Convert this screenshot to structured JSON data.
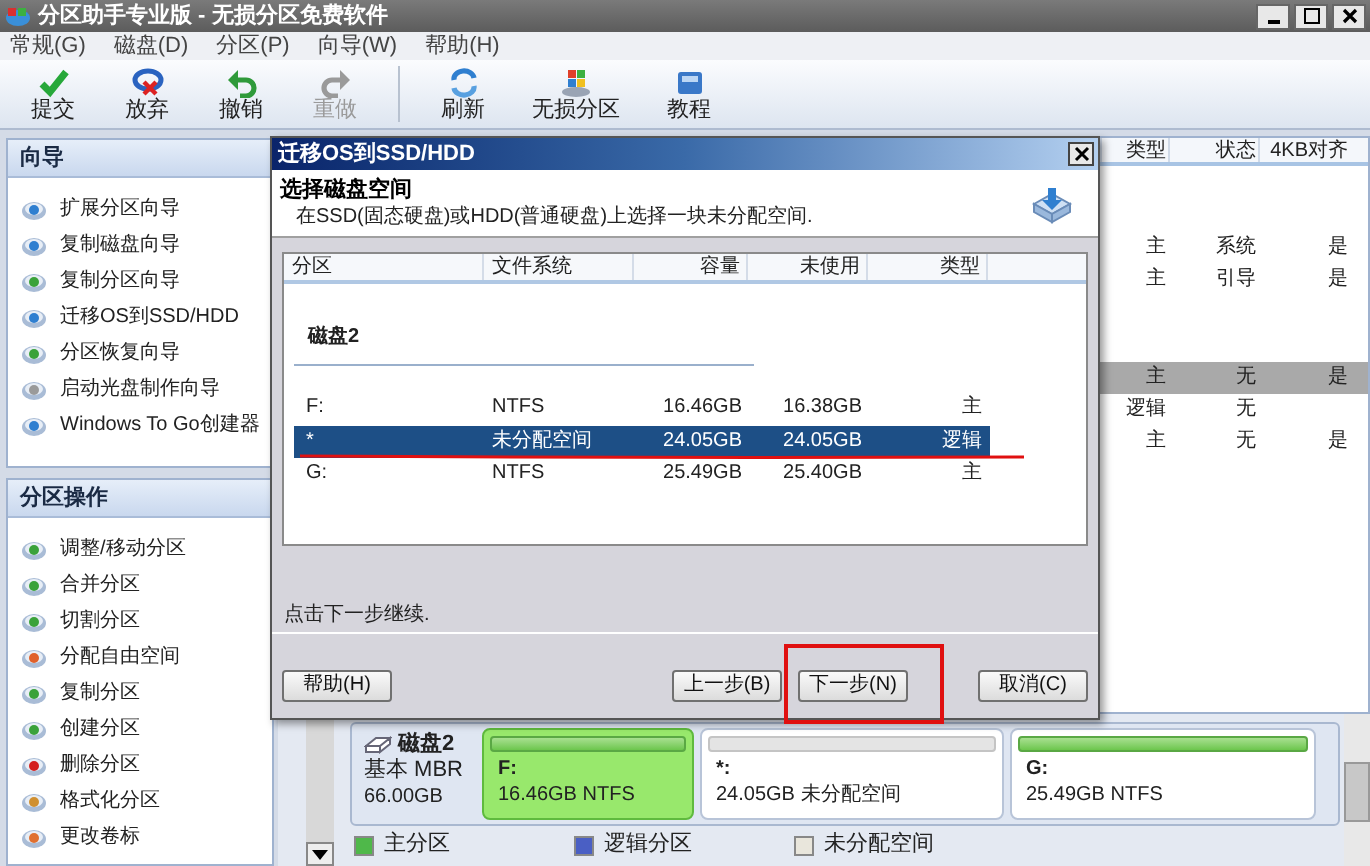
{
  "window": {
    "title": "分区助手专业版 - 无损分区免费软件"
  },
  "menu": [
    "常规(G)",
    "磁盘(D)",
    "分区(P)",
    "向导(W)",
    "帮助(H)"
  ],
  "toolbar": [
    {
      "label": "提交",
      "kind": "check",
      "disabled": false
    },
    {
      "label": "放弃",
      "kind": "discard",
      "disabled": false
    },
    {
      "label": "撤销",
      "kind": "undo",
      "disabled": false
    },
    {
      "label": "重做",
      "kind": "redo",
      "disabled": true
    },
    {
      "kind": "separator"
    },
    {
      "label": "刷新",
      "kind": "refresh",
      "disabled": false
    },
    {
      "label": "无损分区",
      "kind": "squares",
      "disabled": false
    },
    {
      "label": "教程",
      "kind": "book",
      "disabled": false
    }
  ],
  "sidebar": {
    "sections": [
      {
        "title": "向导",
        "items": [
          {
            "label": "扩展分区向导",
            "color": "#2f7fd0"
          },
          {
            "label": "复制磁盘向导",
            "color": "#2f7fd0"
          },
          {
            "label": "复制分区向导",
            "color": "#3aa23a"
          },
          {
            "label": "迁移OS到SSD/HDD",
            "color": "#2f7fd0"
          },
          {
            "label": "分区恢复向导",
            "color": "#3aa23a"
          },
          {
            "label": "启动光盘制作向导",
            "color": "#9a9a9a"
          },
          {
            "label": "Windows To Go创建器",
            "color": "#2f7fd0"
          }
        ]
      },
      {
        "title": "分区操作",
        "items": [
          {
            "label": "调整/移动分区",
            "color": "#3aa23a"
          },
          {
            "label": "合并分区",
            "color": "#3aa23a"
          },
          {
            "label": "切割分区",
            "color": "#3aa23a"
          },
          {
            "label": "分配自由空间",
            "color": "#e0602a"
          },
          {
            "label": "复制分区",
            "color": "#3aa23a"
          },
          {
            "label": "创建分区",
            "color": "#3aa23a"
          },
          {
            "label": "删除分区",
            "color": "#d42020"
          },
          {
            "label": "格式化分区",
            "color": "#d09030"
          },
          {
            "label": "更改卷标",
            "color": "#e07030"
          }
        ]
      }
    ]
  },
  "table": {
    "columns": [
      "类型",
      "状态",
      "4KB对齐"
    ],
    "groups": [
      {
        "rows": [
          {
            "cells": [
              "主",
              "系统",
              "是"
            ],
            "selected": false
          },
          {
            "cells": [
              "主",
              "引导",
              "是"
            ],
            "selected": false
          }
        ]
      },
      {
        "rows": [
          {
            "cells": [
              "主",
              "无",
              "是"
            ],
            "selected": true
          },
          {
            "cells": [
              "逻辑",
              "无",
              ""
            ],
            "selected": false
          },
          {
            "cells": [
              "主",
              "无",
              "是"
            ],
            "selected": false
          }
        ]
      }
    ]
  },
  "dialog": {
    "title": "迁移OS到SSD/HDD",
    "heading": "选择磁盘空间",
    "subtitle": "在SSD(固态硬盘)或HDD(普通硬盘)上选择一块未分配空间.",
    "list": {
      "columns": [
        "分区",
        "文件系统",
        "容量",
        "未使用",
        "类型"
      ],
      "group": "磁盘2",
      "rows": [
        {
          "cells": [
            "F:",
            "NTFS",
            "16.46GB",
            "16.38GB",
            "主"
          ],
          "selected": false,
          "underlined": false
        },
        {
          "cells": [
            "*",
            "未分配空间",
            "24.05GB",
            "24.05GB",
            "逻辑"
          ],
          "selected": true,
          "underlined": true
        },
        {
          "cells": [
            "G:",
            "NTFS",
            "25.49GB",
            "25.40GB",
            "主"
          ],
          "selected": false,
          "underlined": false
        }
      ]
    },
    "hint": "点击下一步继续.",
    "buttons": [
      {
        "label": "帮助(H)",
        "kind": "help",
        "highlighted": false
      },
      {
        "label": "上一步(B)",
        "kind": "nav",
        "highlighted": false
      },
      {
        "label": "下一步(N)",
        "kind": "nav",
        "highlighted": true
      },
      {
        "label": "取消(C)",
        "kind": "cancel",
        "highlighted": false
      }
    ]
  },
  "disk_map": {
    "disk": {
      "name": "磁盘2",
      "type": "基本 MBR",
      "size": "66.00GB"
    },
    "partitions": [
      {
        "label": "F:",
        "detail": "16.46GB NTFS",
        "kind": "primary",
        "selected": true
      },
      {
        "label": "*:",
        "detail": "24.05GB 未分配空间",
        "kind": "unallocated",
        "selected": false
      },
      {
        "label": "G:",
        "detail": "25.49GB NTFS",
        "kind": "primary",
        "selected": false
      }
    ]
  },
  "legend": [
    {
      "label": "主分区",
      "color": "#4fb84a"
    },
    {
      "label": "逻辑分区",
      "color": "#4a5fc4"
    },
    {
      "label": "未分配空间",
      "color": "#e9e6dc"
    }
  ]
}
